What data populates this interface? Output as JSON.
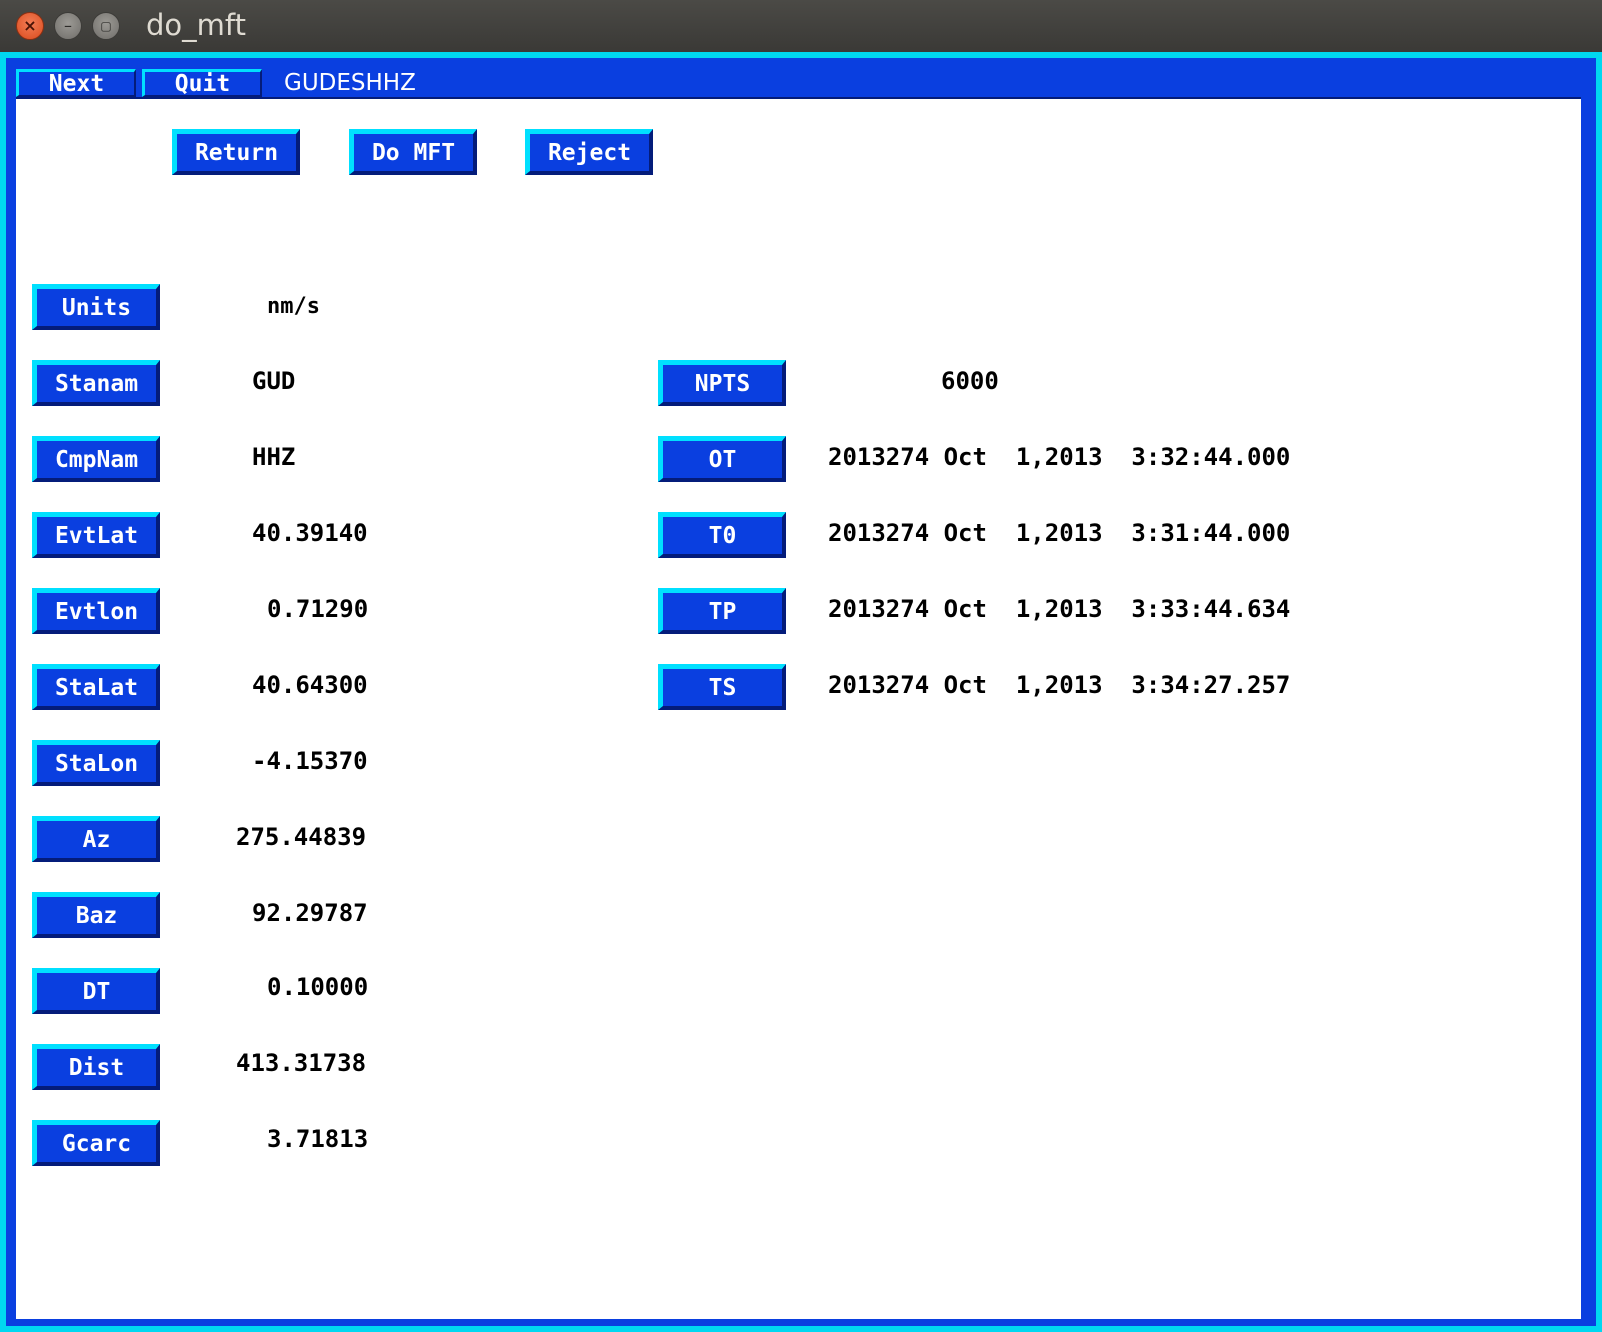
{
  "window": {
    "title": "do_mft"
  },
  "menubar": {
    "next_label": "Next",
    "quit_label": "Quit",
    "title": "GUDESHHZ"
  },
  "actions": {
    "return_label": "Return",
    "do_mft_label": "Do MFT",
    "reject_label": "Reject"
  },
  "fields": [
    {
      "label": "Units",
      "value": "nm/s"
    },
    {
      "label": "Stanam",
      "value": "GUD"
    },
    {
      "label": "CmpNam",
      "value": "HHZ"
    },
    {
      "label": "EvtLat",
      "value": "40.39140"
    },
    {
      "label": "Evtlon",
      "value": "0.71290"
    },
    {
      "label": "StaLat",
      "value": "40.64300"
    },
    {
      "label": "StaLon",
      "value": "-4.15370"
    },
    {
      "label": "Az",
      "value": "275.44839"
    },
    {
      "label": "Baz",
      "value": "92.29787"
    },
    {
      "label": "DT",
      "value": "0.10000"
    },
    {
      "label": "Dist",
      "value": "413.31738"
    },
    {
      "label": "Gcarc",
      "value": "3.71813"
    }
  ],
  "timing": [
    {
      "label": "NPTS",
      "value": "6000"
    },
    {
      "label": "OT",
      "value": "2013274 Oct  1,2013  3:32:44.000"
    },
    {
      "label": "T0",
      "value": "2013274 Oct  1,2013  3:31:44.000"
    },
    {
      "label": "TP",
      "value": "2013274 Oct  1,2013  3:33:44.634"
    },
    {
      "label": "TS",
      "value": "2013274 Oct  1,2013  3:34:27.257"
    }
  ]
}
